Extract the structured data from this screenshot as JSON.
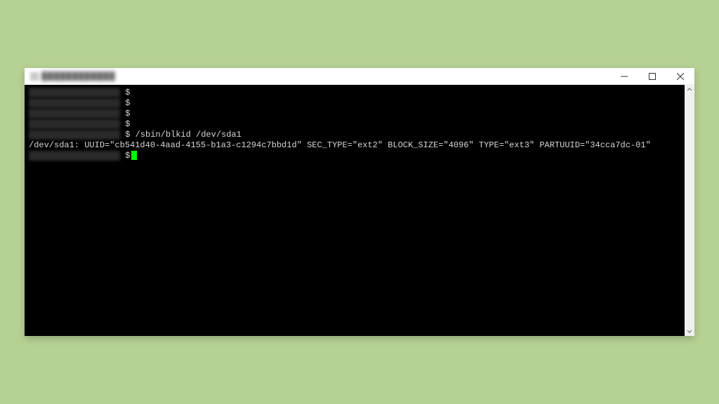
{
  "window": {
    "title": "████████████"
  },
  "terminal": {
    "prompt_char": " $",
    "lines": [
      {
        "redacted": true,
        "cmd": ""
      },
      {
        "redacted": true,
        "cmd": ""
      },
      {
        "redacted": true,
        "cmd": ""
      },
      {
        "redacted": true,
        "cmd": ""
      },
      {
        "redacted": true,
        "cmd": " /sbin/blkid /dev/sda1"
      }
    ],
    "output_line": "/dev/sda1: UUID=\"cb541d40-4aad-4155-b1a3-c1294c7bbd1d\" SEC_TYPE=\"ext2\" BLOCK_SIZE=\"4096\" TYPE=\"ext3\" PARTUUID=\"34cca7dc-01\"",
    "final_prompt": " $"
  }
}
